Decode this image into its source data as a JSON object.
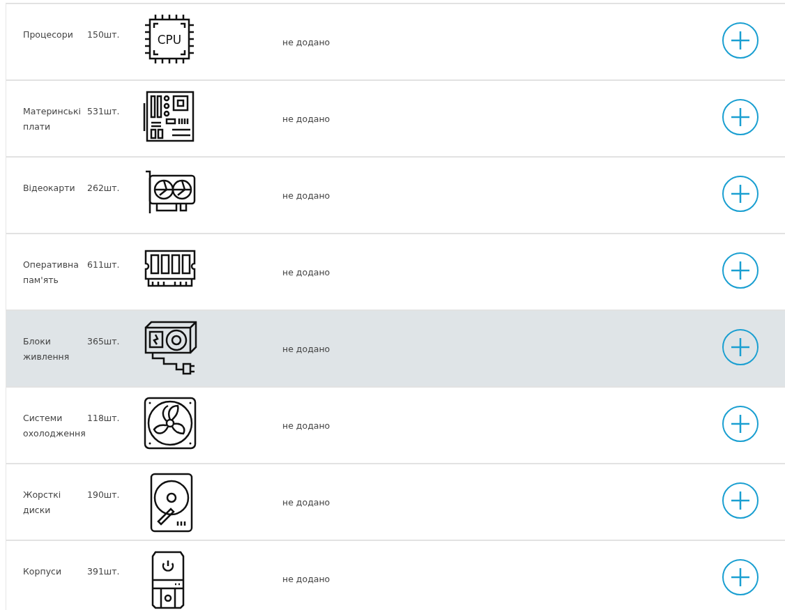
{
  "categories": [
    {
      "name": "Процесори",
      "count": "150шт.",
      "icon": {
        "kind": "cpu",
        "label": "CPU"
      },
      "status": "не додано",
      "selected": false
    },
    {
      "name": "Материнські плати",
      "count": "531шт.",
      "icon": {
        "kind": "motherboard"
      },
      "status": "не додано",
      "selected": false
    },
    {
      "name": "Відеокарти",
      "count": "262шт.",
      "icon": {
        "kind": "gpu"
      },
      "status": "не додано",
      "selected": false
    },
    {
      "name": "Оперативна пам'ять",
      "count": "611шт.",
      "icon": {
        "kind": "ram"
      },
      "status": "не додано",
      "selected": false
    },
    {
      "name": "Блоки живлення",
      "count": "365шт.",
      "icon": {
        "kind": "psu"
      },
      "status": "не додано",
      "selected": true
    },
    {
      "name": "Системи охолодження",
      "count": "118шт.",
      "icon": {
        "kind": "fan"
      },
      "status": "не додано",
      "selected": false
    },
    {
      "name": "Жорсткі диски",
      "count": "190шт.",
      "icon": {
        "kind": "hdd"
      },
      "status": "не додано",
      "selected": false
    },
    {
      "name": "Корпуси",
      "count": "391шт.",
      "icon": {
        "kind": "case"
      },
      "status": "не додано",
      "selected": false
    }
  ]
}
